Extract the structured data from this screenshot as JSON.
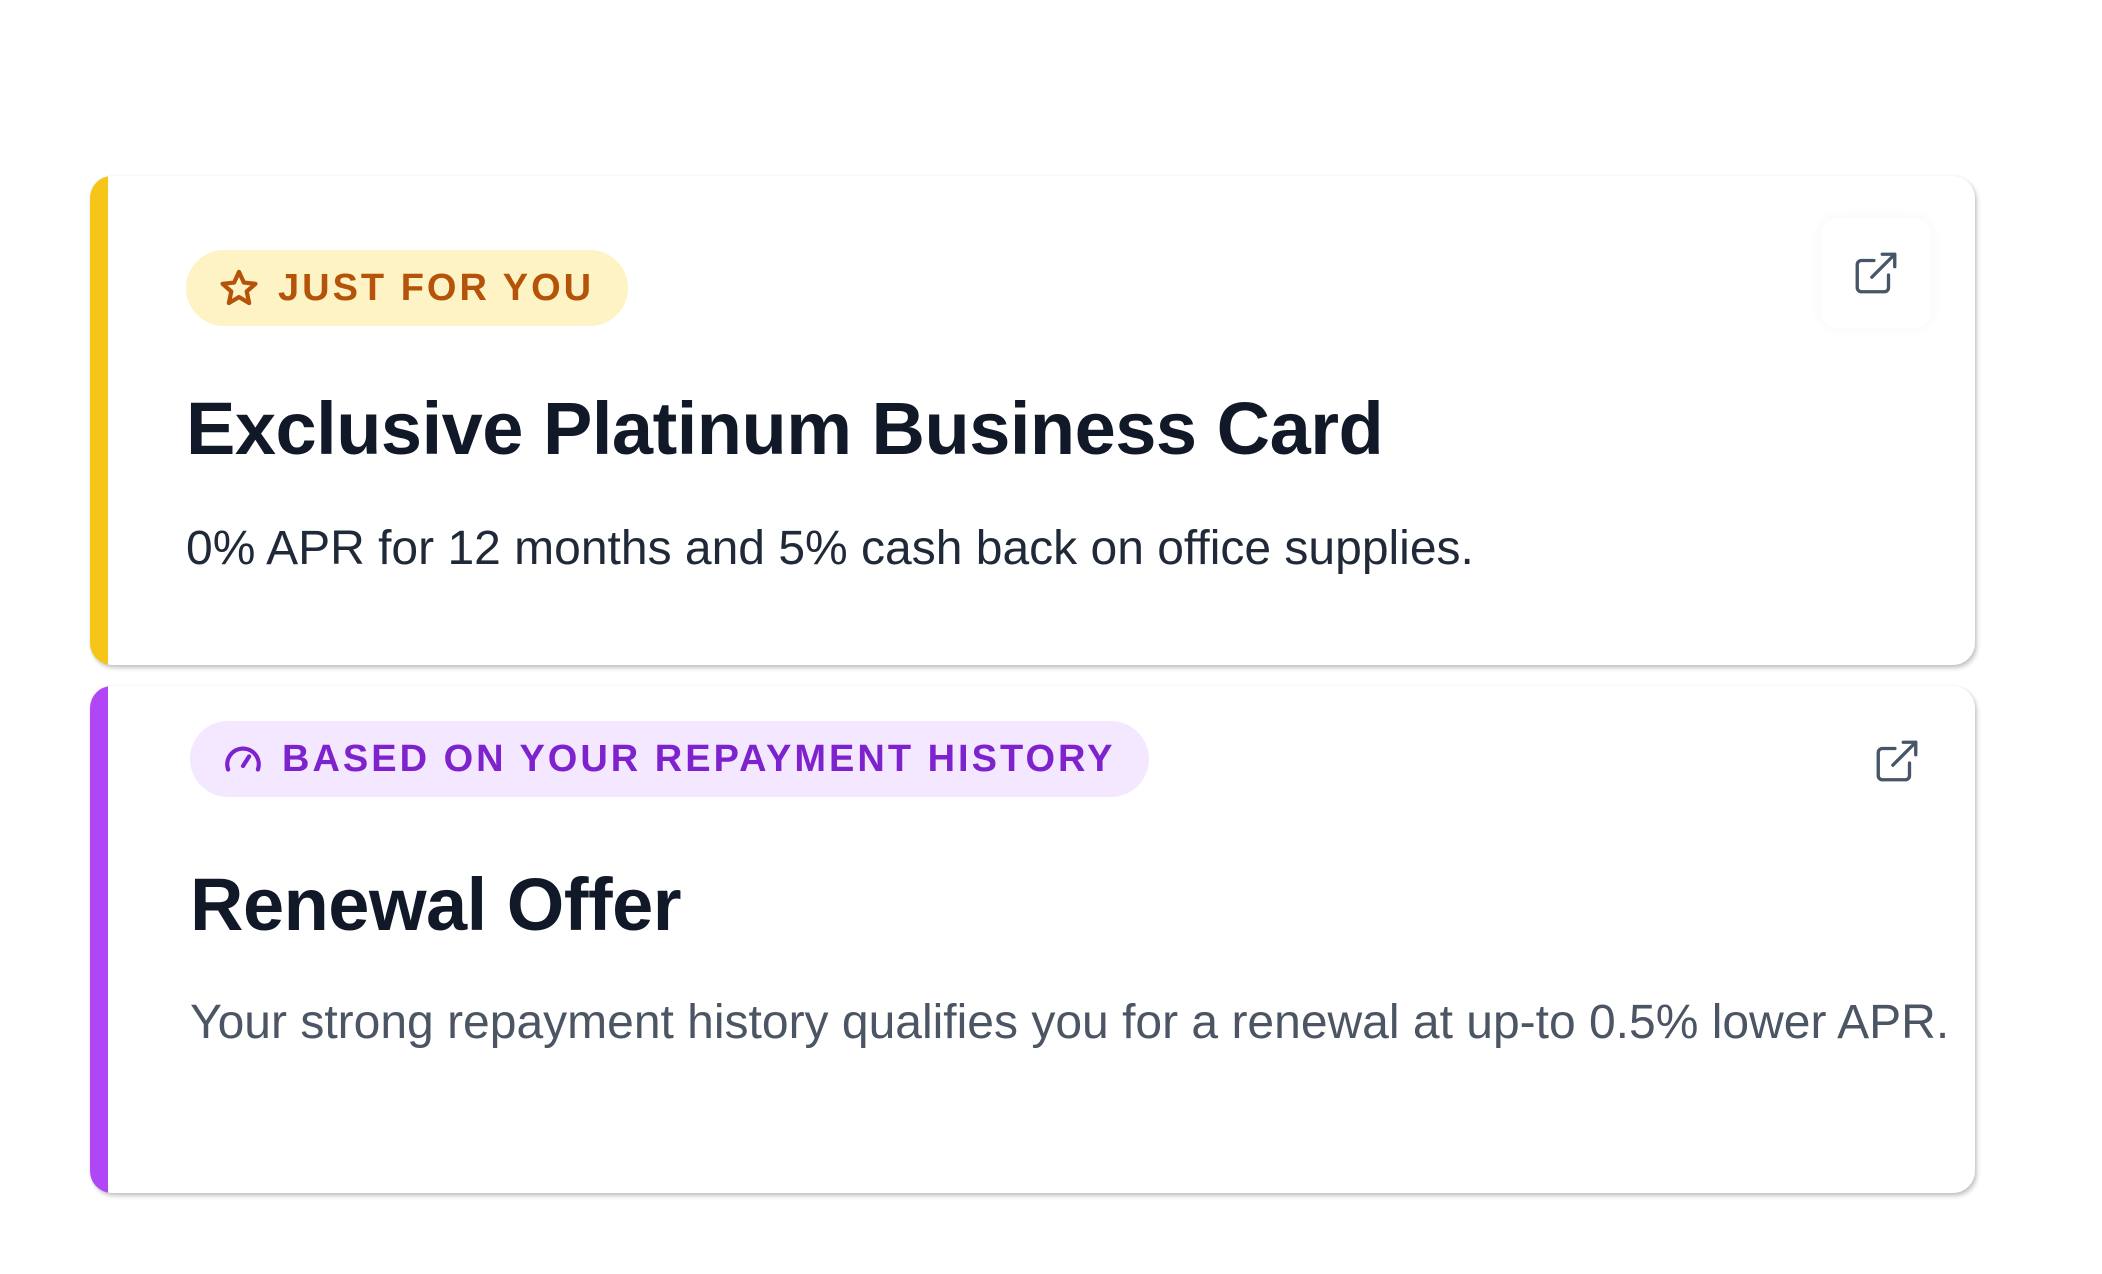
{
  "cards": [
    {
      "badge_label": "JUST FOR YOU",
      "badge_icon": "star-icon",
      "title": "Exclusive Platinum Business Card",
      "description": "0% APR for 12 months and 5% cash back on office supplies.",
      "action_icon": "external-link-icon",
      "colors": {
        "accent": "#f5c518",
        "badge_bg": "#fdf3c4",
        "badge_text": "#b45309"
      }
    },
    {
      "badge_label": "BASED ON YOUR REPAYMENT HISTORY",
      "badge_icon": "gauge-icon",
      "title": "Renewal Offer",
      "description": "Your strong repayment history qualifies you for a renewal at up-to 0.5% lower APR.",
      "action_icon": "external-link-icon",
      "colors": {
        "accent": "#b046f6",
        "badge_bg": "#f3e8ff",
        "badge_text": "#7e22ce"
      }
    }
  ]
}
